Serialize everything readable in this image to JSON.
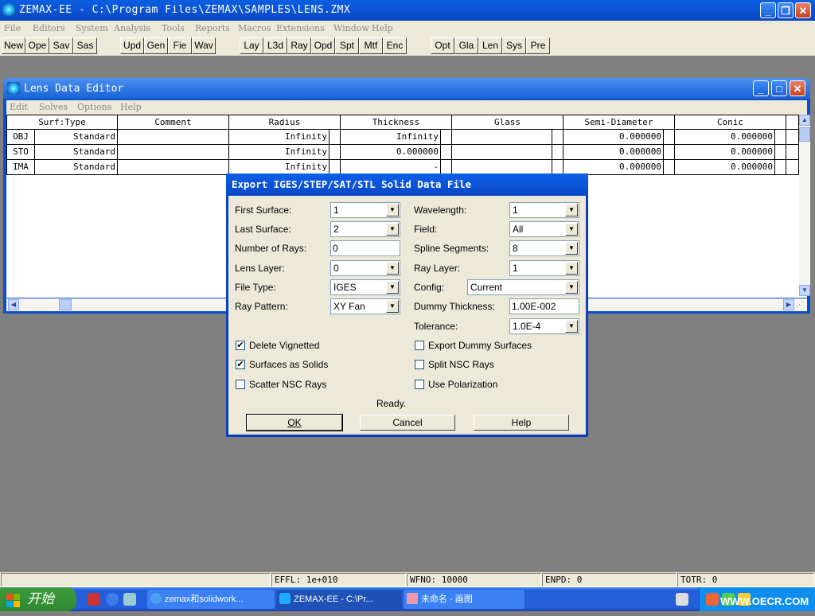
{
  "app": {
    "title": "ZEMAX-EE - C:\\Program Files\\ZEMAX\\SAMPLES\\LENS.ZMX",
    "min_glyph": "_",
    "max_glyph": "❐",
    "close_glyph": "✕"
  },
  "menu": [
    "File",
    "Editors",
    "System",
    "Analysis",
    "Tools",
    "Reports",
    "Macros",
    "Extensions",
    "Window",
    "Help"
  ],
  "toolbar": {
    "group1": [
      "New",
      "Ope",
      "Sav",
      "Sas"
    ],
    "group2": [
      "Upd",
      "Gen",
      "Fie",
      "Wav"
    ],
    "group3": [
      "Lay",
      "L3d",
      "Ray",
      "Opd",
      "Spt",
      "Mtf",
      "Enc"
    ],
    "group4": [
      "Opt",
      "Gla",
      "Len",
      "Sys",
      "Pre"
    ]
  },
  "lens_editor": {
    "title": "Lens Data Editor",
    "menu": [
      "Edit",
      "Solves",
      "Options",
      "Help"
    ],
    "columns": [
      "Surf:Type",
      "Comment",
      "Radius",
      "Thickness",
      "Glass",
      "Semi-Diameter",
      "Conic"
    ],
    "rows": [
      {
        "surf": "OBJ",
        "type": "Standard",
        "comment": "",
        "radius": "Infinity",
        "thickness": "Infinity",
        "glass": "",
        "semi": "0.000000",
        "conic": "0.000000"
      },
      {
        "surf": "STO",
        "type": "Standard",
        "comment": "",
        "radius": "Infinity",
        "thickness": "0.000000",
        "glass": "",
        "semi": "0.000000",
        "conic": "0.000000"
      },
      {
        "surf": "IMA",
        "type": "Standard",
        "comment": "",
        "radius": "Infinity",
        "thickness": "-",
        "glass": "",
        "semi": "0.000000",
        "conic": "0.000000"
      }
    ]
  },
  "dialog": {
    "title": "Export IGES/STEP/SAT/STL Solid Data File",
    "first_surface": {
      "label": "First Surface:",
      "value": "1"
    },
    "last_surface": {
      "label": "Last Surface:",
      "value": "2"
    },
    "num_rays": {
      "label": "Number of Rays:",
      "value": "0"
    },
    "lens_layer": {
      "label": "Lens Layer:",
      "value": "0"
    },
    "file_type": {
      "label": "File Type:",
      "value": "IGES"
    },
    "ray_pattern": {
      "label": "Ray Pattern:",
      "value": "XY Fan"
    },
    "wavelength": {
      "label": "Wavelength:",
      "value": "1"
    },
    "field": {
      "label": "Field:",
      "value": "All"
    },
    "spline_segments": {
      "label": "Spline Segments:",
      "value": "8"
    },
    "ray_layer": {
      "label": "Ray Layer:",
      "value": "1"
    },
    "config": {
      "label": "Config:",
      "value": "Current"
    },
    "dummy_thickness": {
      "label": "Dummy Thickness:",
      "value": "1.00E-002"
    },
    "tolerance": {
      "label": "Tolerance:",
      "value": "1.0E-4"
    },
    "delete_vignetted": {
      "label": "Delete Vignetted",
      "checked": true
    },
    "surfaces_as_solids": {
      "label": "Surfaces as Solids",
      "checked": true
    },
    "scatter_nsc_rays": {
      "label": "Scatter NSC Rays",
      "checked": false
    },
    "export_dummy_surfaces": {
      "label": "Export Dummy Surfaces",
      "checked": false
    },
    "split_nsc_rays": {
      "label": "Split NSC Rays",
      "checked": false
    },
    "use_polarization": {
      "label": "Use Polarization",
      "checked": false
    },
    "status": "Ready.",
    "ok": "OK",
    "cancel": "Cancel",
    "help": "Help",
    "check_glyph": "✔"
  },
  "statusbar": {
    "effl": "EFFL: 1e+010",
    "wfno": "WFNO: 10000",
    "enpd": "ENPD: 0",
    "totr": "TOTR: 0"
  },
  "taskbar": {
    "start": "开始",
    "items": [
      "zemax和solidwork...",
      "ZEMAX-EE - C:\\Pr...",
      "未命名 - 画图"
    ],
    "watermark": "WWW.OECR.COM"
  }
}
